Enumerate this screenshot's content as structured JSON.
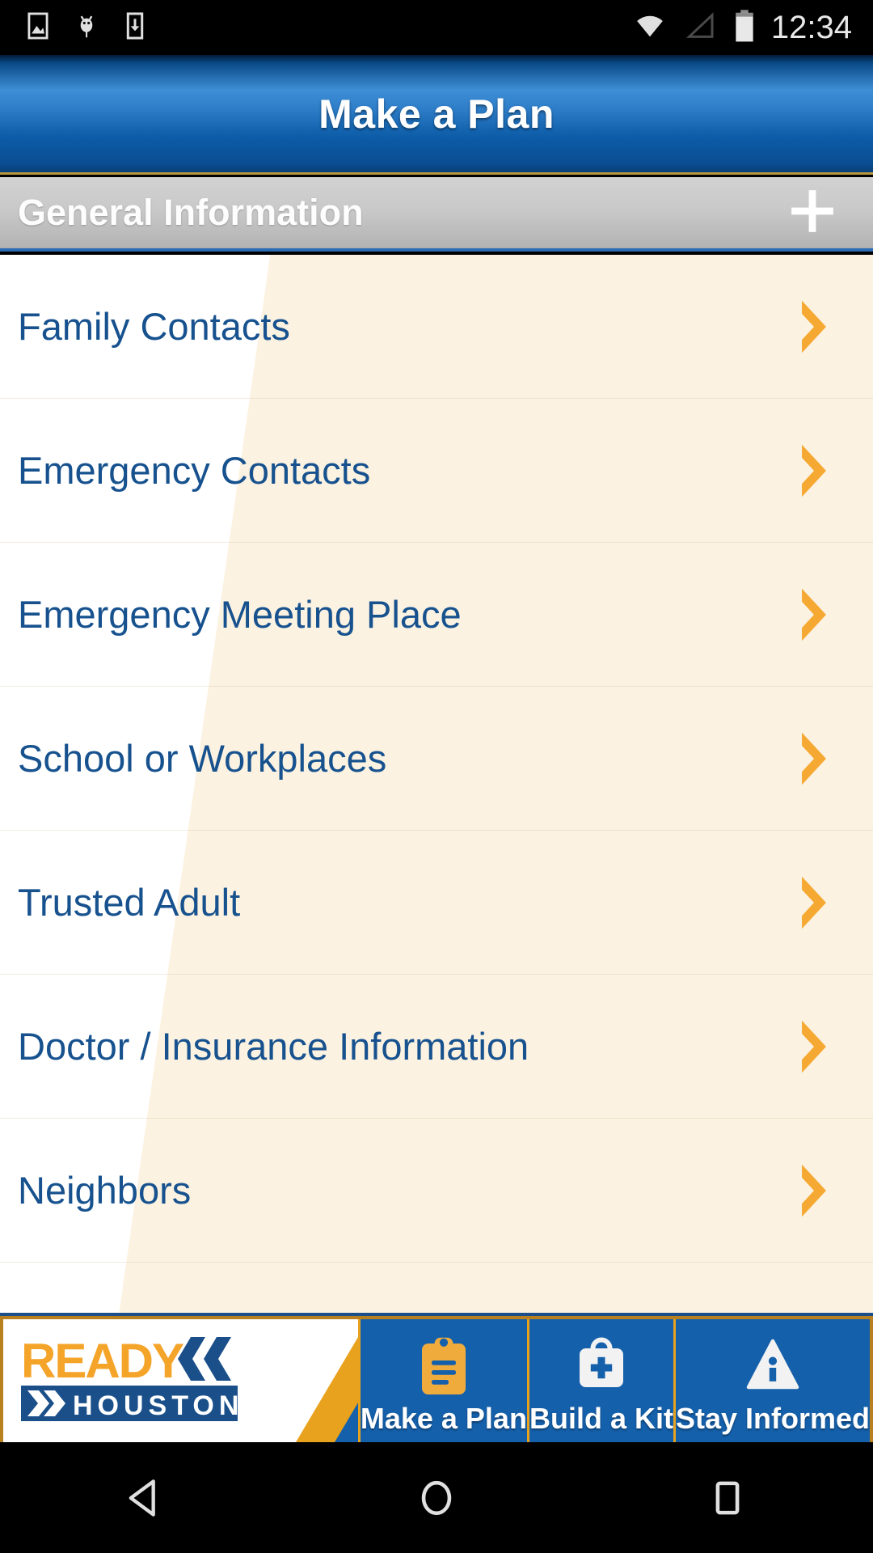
{
  "status_bar": {
    "time": "12:34",
    "icons_left": [
      "image-icon",
      "android-bug-icon",
      "download-icon"
    ],
    "icons_right": [
      "wifi-icon",
      "cell-signal-icon",
      "battery-icon"
    ]
  },
  "header": {
    "title": "Make a Plan"
  },
  "section": {
    "title": "General Information",
    "add_icon": "plus-icon"
  },
  "list": {
    "items": [
      {
        "label": "Family Contacts"
      },
      {
        "label": "Emergency Contacts"
      },
      {
        "label": "Emergency Meeting Place"
      },
      {
        "label": "School or Workplaces"
      },
      {
        "label": "Trusted Adult"
      },
      {
        "label": "Doctor / Insurance Information"
      },
      {
        "label": "Neighbors"
      }
    ],
    "chevron_icon": "chevron-right-icon"
  },
  "tab_bar": {
    "logo": {
      "word_top": "READY",
      "word_bottom": "HOUSTON",
      "chevrons_icon": "double-chevron-left-icon",
      "banner_chevron_icon": "double-chevron-right-icon"
    },
    "tabs": [
      {
        "label": "Make a Plan",
        "icon": "clipboard-icon"
      },
      {
        "label": "Build a Kit",
        "icon": "first-aid-kit-icon"
      },
      {
        "label": "Stay Informed",
        "icon": "info-triangle-icon"
      }
    ]
  },
  "android_nav": {
    "back": "back-triangle-icon",
    "home": "home-circle-icon",
    "recents": "recents-square-icon"
  },
  "colors": {
    "header_blue": "#1560ab",
    "accent_orange": "#f5a933",
    "link_blue": "#17528f",
    "band_cream": "#fdf3e3",
    "gold_border": "#e8a21e"
  }
}
